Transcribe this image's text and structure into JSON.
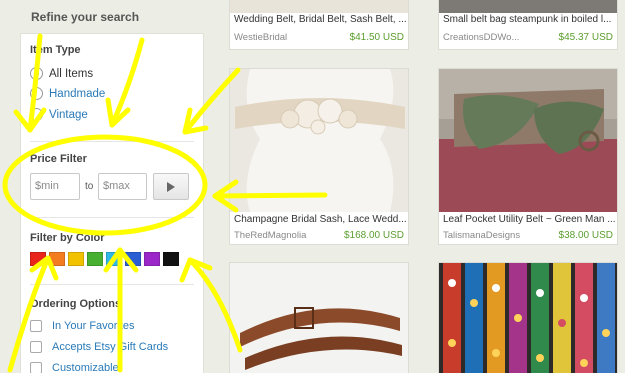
{
  "sidebar": {
    "refine_title": "Refine your search",
    "item_type": {
      "title": "Item Type",
      "options": [
        "All Items",
        "Handmade",
        "Vintage"
      ],
      "selected": "All Items"
    },
    "price_filter": {
      "title": "Price Filter",
      "min_placeholder": "$min",
      "to_label": "to",
      "max_placeholder": "$max",
      "submit_icon": "play-triangle-icon"
    },
    "color_filter": {
      "title": "Filter by Color",
      "swatches": [
        "#e8261c",
        "#f47c20",
        "#f2c200",
        "#48b030",
        "#2fb7e6",
        "#2a5fd3",
        "#9b27c9",
        "#111111"
      ]
    },
    "ordering": {
      "title": "Ordering Options",
      "options": [
        "In Your Favorites",
        "Accepts Etsy Gift Cards",
        "Customizable"
      ]
    }
  },
  "listings": [
    {
      "title": "Wedding Belt, Bridal Belt, Sash Belt, ...",
      "shop": "WestieBridal",
      "price": "$41.50 USD"
    },
    {
      "title": "Small belt bag steampunk in boiled l...",
      "shop": "CreationsDDWo...",
      "price": "$45.37 USD"
    },
    {
      "title": "Champagne Bridal Sash, Lace Wedd...",
      "shop": "TheRedMagnolia",
      "price": "$168.00 USD"
    },
    {
      "title": "Leaf Pocket Utility Belt ~ Green Man ...",
      "shop": "TalismanaDesigns",
      "price": "$38.00 USD"
    }
  ],
  "colors": {
    "link": "#2a7ab8",
    "price": "#5b9e2e",
    "annotation": "#ffff00"
  }
}
